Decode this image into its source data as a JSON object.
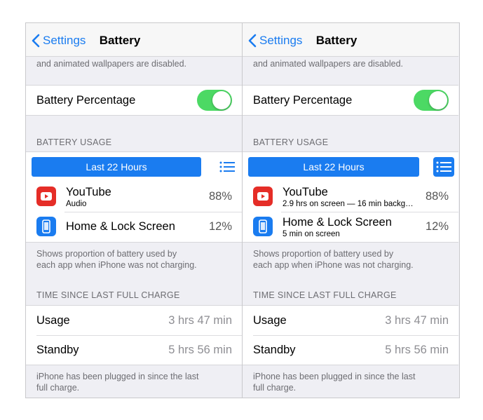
{
  "nav": {
    "back_label": "Settings",
    "title": "Battery"
  },
  "low_power_footer": "and animated wallpapers are disabled.",
  "battery_percentage": {
    "label": "Battery Percentage",
    "enabled": true
  },
  "battery_usage": {
    "header": "BATTERY USAGE",
    "range_button": "Last 22 Hours",
    "footer_line1": "Shows proportion of battery used by",
    "footer_line2": "each app when iPhone was not charging."
  },
  "left_apps": [
    {
      "name": "YouTube",
      "detail": "Audio",
      "percent": "88%",
      "icon": "youtube-icon"
    },
    {
      "name": "Home & Lock Screen",
      "detail": "",
      "percent": "12%",
      "icon": "phone-screen-icon"
    }
  ],
  "right_apps": [
    {
      "name": "YouTube",
      "detail": "2.9 hrs on screen — 16 min backg…",
      "percent": "88%",
      "icon": "youtube-icon"
    },
    {
      "name": "Home & Lock Screen",
      "detail": "5 min on screen",
      "percent": "12%",
      "icon": "phone-screen-icon"
    }
  ],
  "time_since": {
    "header": "TIME SINCE LAST FULL CHARGE",
    "usage_label": "Usage",
    "usage_value": "3 hrs 47 min",
    "standby_label": "Standby",
    "standby_value": "5 hrs 56 min",
    "footer_line1": "iPhone has been plugged in since the last",
    "footer_line2": "full charge."
  },
  "colors": {
    "accent": "#1a7cf0",
    "toggle_on": "#4cd964",
    "youtube_red": "#e52d27"
  }
}
